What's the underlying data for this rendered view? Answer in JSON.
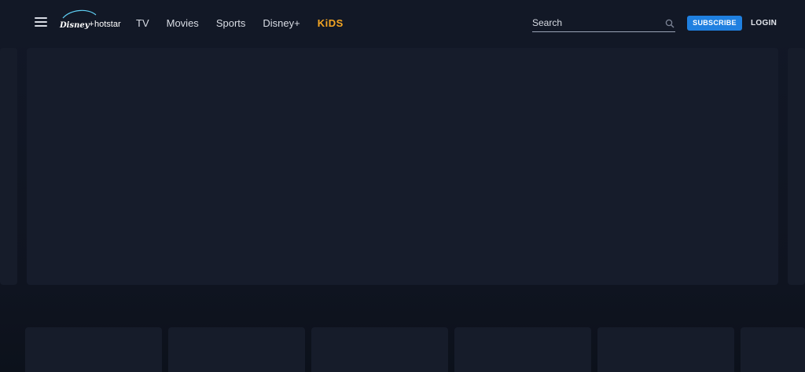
{
  "header": {
    "logo_text": "Disney+ hotstar",
    "nav": {
      "tv": "TV",
      "movies": "Movies",
      "sports": "Sports",
      "disney_plus": "Disney+",
      "kids": "KiDS"
    },
    "search_placeholder": "Search",
    "subscribe_label": "SUBSCRIBE",
    "login_label": "LOGIN"
  },
  "colors": {
    "background": "#0c111b",
    "header": "#121826",
    "card_placeholder": "#161c2b",
    "subscribe_blue": "#1f80e0",
    "kids_orange": "#f5a623"
  },
  "icons": {
    "menu": "hamburger-menu-icon",
    "search": "search-icon"
  }
}
